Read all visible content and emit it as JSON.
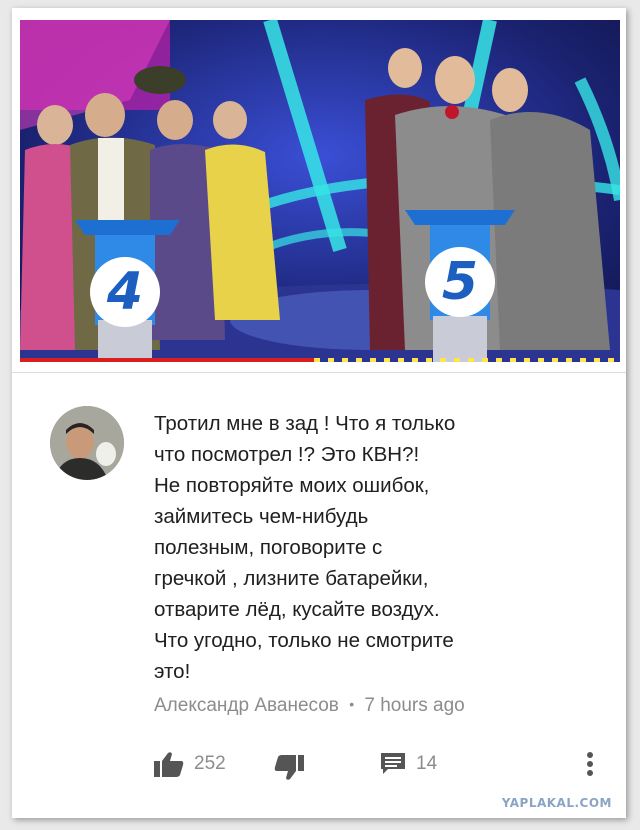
{
  "video": {
    "progress_fraction": 0.49,
    "podium_left_number": "4",
    "podium_right_number": "5"
  },
  "comment": {
    "text": "Тротил мне в зад ! Что я только\nчто посмотрел !? Это КВН?!\nНе повторяйте моих ошибок,\nзаймитесь чем-нибудь\nполезным, поговорите с\nгречкой , лизните батарейки,\nотварите лёд, кусайте воздух.\nЧто угодно, только не смотрите\nэто!",
    "author": "Александр Аванесов",
    "separator": "•",
    "time": "7 hours ago"
  },
  "actions": {
    "like_icon": "thumbs-up-icon",
    "like_count": "252",
    "dislike_icon": "thumbs-down-icon",
    "reply_icon": "reply-icon",
    "reply_count": "14",
    "more_icon": "more-vertical-icon"
  },
  "watermark": "YAPLAKAL.COM",
  "colors": {
    "text": "#202020",
    "meta": "#8c8c8c",
    "progress_played": "#d81e1e",
    "progress_buffer": "#ffe44d",
    "podium_number": "#1c5fc1"
  }
}
